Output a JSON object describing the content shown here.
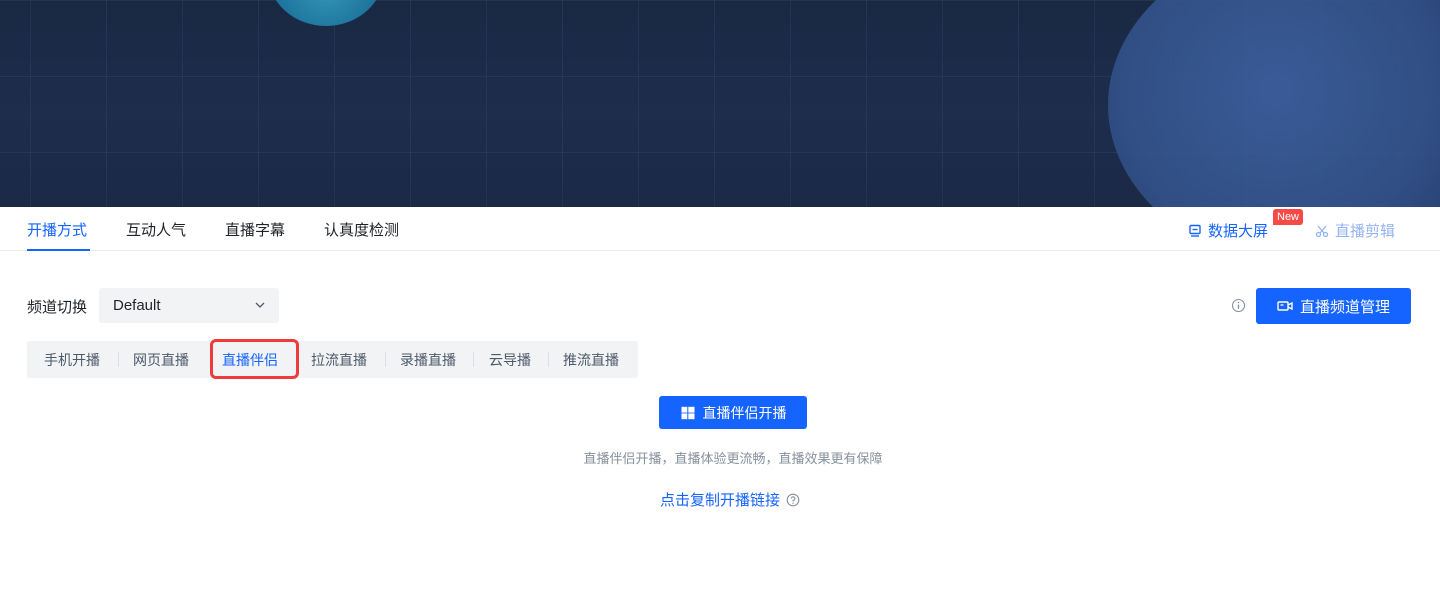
{
  "tabs": [
    {
      "label": "开播方式",
      "active": true
    },
    {
      "label": "互动人气",
      "active": false
    },
    {
      "label": "直播字幕",
      "active": false
    },
    {
      "label": "认真度检测",
      "active": false
    }
  ],
  "header_links": {
    "data_screen": {
      "label": "数据大屏",
      "icon": "monitor-icon",
      "badge": "New"
    },
    "live_edit": {
      "label": "直播剪辑",
      "icon": "scissors-icon"
    }
  },
  "channel": {
    "label": "频道切换",
    "selected": "Default"
  },
  "manage_button": {
    "label": "直播频道管理",
    "icon": "video-camera-icon"
  },
  "modes": [
    {
      "label": "手机开播",
      "active": false
    },
    {
      "label": "网页直播",
      "active": false
    },
    {
      "label": "直播伴侣",
      "active": true
    },
    {
      "label": "拉流直播",
      "active": false
    },
    {
      "label": "录播直播",
      "active": false
    },
    {
      "label": "云导播",
      "active": false
    },
    {
      "label": "推流直播",
      "active": false
    }
  ],
  "start_button": {
    "label": "直播伴侣开播",
    "icon": "windows-icon"
  },
  "hint": "直播伴侣开播，直播体验更流畅，直播效果更有保障",
  "copy_link": {
    "label": "点击复制开播链接",
    "icon": "question-circle-icon"
  },
  "colors": {
    "accent": "#1664ff",
    "badge": "#f54a45",
    "highlight": "#ee3b3b"
  }
}
